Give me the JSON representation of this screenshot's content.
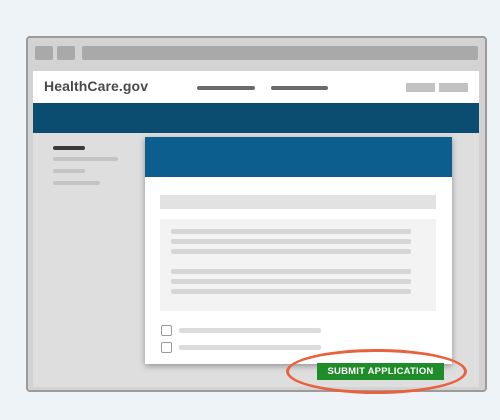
{
  "site": {
    "logo": "HealthCare.gov"
  },
  "modal": {
    "submit_label": "SUBMIT APPLICATION"
  },
  "colors": {
    "header_band": "#0a4d70",
    "modal_header": "#0b5e8e",
    "submit_button": "#1f8c2a",
    "highlight_ring": "#e8623f"
  },
  "icons": [
    "browser-button-icon",
    "checkbox-icon"
  ]
}
